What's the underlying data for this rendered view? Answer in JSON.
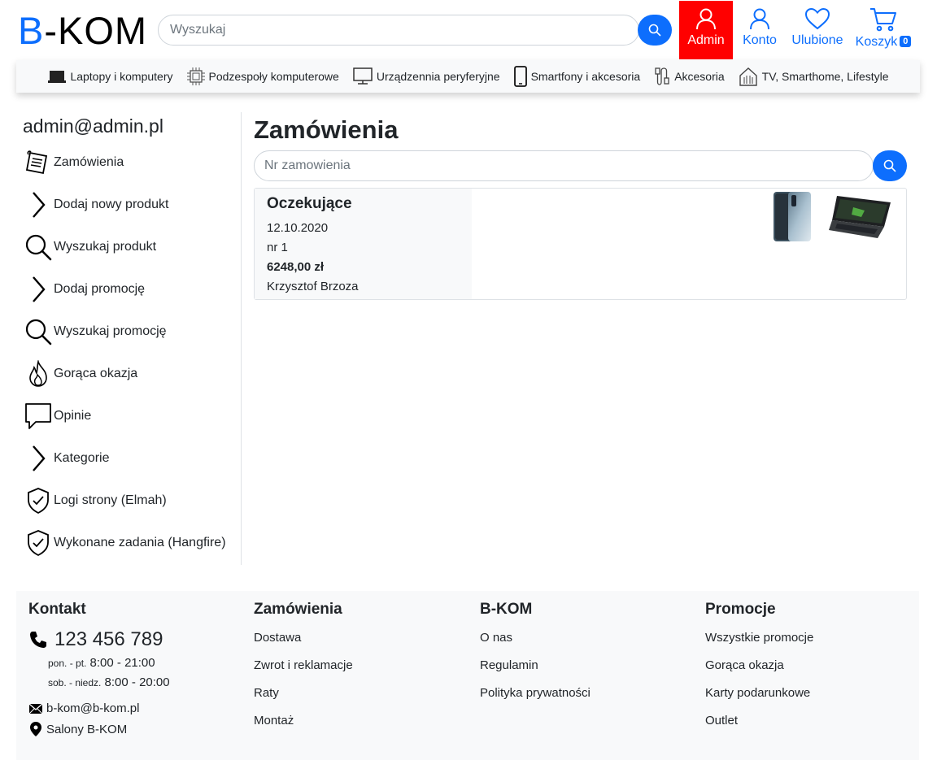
{
  "header": {
    "logo_b": "B",
    "logo_rest": "-KOM",
    "search_placeholder": "Wyszukaj",
    "admin_label": "Admin",
    "account_label": "Konto",
    "favorites_label": "Ulubione",
    "cart_label": "Koszyk",
    "cart_count": "0",
    "accent_color": "#0d6efd",
    "admin_color": "#ff0000"
  },
  "categories": [
    {
      "label": "Laptopy i komputery",
      "icon": "laptop-icon"
    },
    {
      "label": "Podzespoły komputerowe",
      "icon": "cpu-icon"
    },
    {
      "label": "Urządzennia peryferyjne",
      "icon": "monitor-icon"
    },
    {
      "label": "Smartfony i akcesoria",
      "icon": "smartphone-icon"
    },
    {
      "label": "Akcesoria",
      "icon": "cable-icon"
    },
    {
      "label": "TV, Smarthome, Lifestyle",
      "icon": "smarthome-icon"
    }
  ],
  "sidebar": {
    "title": "admin@admin.pl",
    "items": [
      {
        "label": "Zamówienia",
        "icon": "order-list-icon"
      },
      {
        "label": "Dodaj nowy produkt",
        "icon": "chevron-right-icon"
      },
      {
        "label": "Wyszukaj produkt",
        "icon": "search-icon"
      },
      {
        "label": "Dodaj promocję",
        "icon": "chevron-right-icon"
      },
      {
        "label": "Wyszukaj promocję",
        "icon": "search-icon"
      },
      {
        "label": "Gorąca okazja",
        "icon": "flame-icon"
      },
      {
        "label": "Opinie",
        "icon": "speech-bubble-icon"
      },
      {
        "label": "Kategorie",
        "icon": "chevron-right-icon"
      },
      {
        "label": "Logi strony (Elmah)",
        "icon": "shield-check-icon"
      },
      {
        "label": "Wykonane zadania (Hangfire)",
        "icon": "shield-check-icon"
      }
    ]
  },
  "main": {
    "title": "Zamówienia",
    "search_placeholder": "Nr zamowienia",
    "orders": [
      {
        "status": "Oczekujące",
        "date": "12.10.2020",
        "number": "nr 1",
        "total": "6248,00 zł",
        "customer": "Krzysztof Brzoza",
        "product_images": [
          "smartphone-image",
          "laptop-image"
        ]
      }
    ]
  },
  "footer": {
    "contact": {
      "heading": "Kontakt",
      "phone": "123 456 789",
      "hours_weekday_days": "pon. - pt.",
      "hours_weekday_time": "8:00 - 21:00",
      "hours_weekend_days": "sob. - niedz.",
      "hours_weekend_time": "8:00 - 20:00",
      "email": "b-kom@b-kom.pl",
      "stores": "Salony B-KOM"
    },
    "orders": {
      "heading": "Zamówienia",
      "links": [
        "Dostawa",
        "Zwrot i reklamacje",
        "Raty",
        "Montaż"
      ]
    },
    "company": {
      "heading": "B-KOM",
      "links": [
        "O nas",
        "Regulamin",
        "Polityka prywatności"
      ]
    },
    "promotions": {
      "heading": "Promocje",
      "links": [
        "Wszystkie promocje",
        "Gorąca okazja",
        "Karty podarunkowe",
        "Outlet"
      ]
    }
  }
}
